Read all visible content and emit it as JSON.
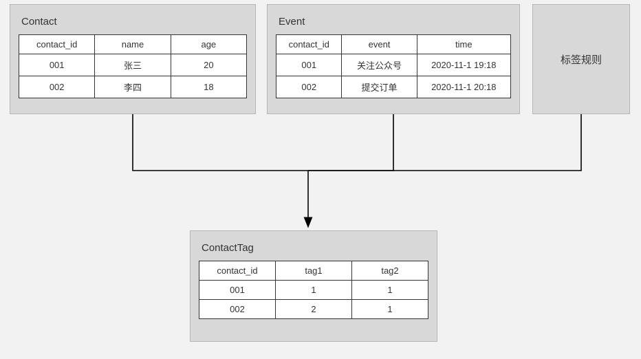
{
  "contact": {
    "title": "Contact",
    "headers": [
      "contact_id",
      "name",
      "age"
    ],
    "rows": [
      [
        "001",
        "张三",
        "20"
      ],
      [
        "002",
        "李四",
        "18"
      ]
    ]
  },
  "event": {
    "title": "Event",
    "headers": [
      "contact_id",
      "event",
      "time"
    ],
    "rows": [
      [
        "001",
        "关注公众号",
        "2020-11-1 19:18"
      ],
      [
        "002",
        "提交订单",
        "2020-11-1 20:18"
      ]
    ]
  },
  "rules": {
    "label": "标签规则"
  },
  "contact_tag": {
    "title": "ContactTag",
    "headers": [
      "contact_id",
      "tag1",
      "tag2"
    ],
    "rows": [
      [
        "001",
        "1",
        "1"
      ],
      [
        "002",
        "2",
        "1"
      ]
    ]
  }
}
